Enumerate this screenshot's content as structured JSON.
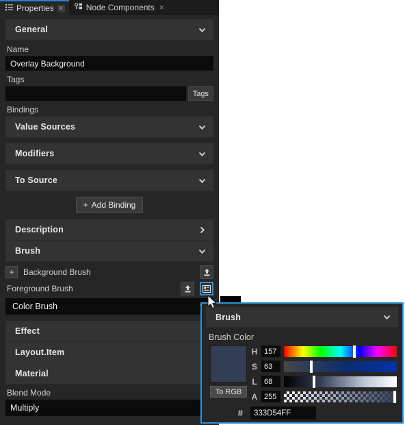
{
  "tabs": [
    {
      "label": "Properties",
      "icon": "list-icon",
      "close": "✕",
      "active": true
    },
    {
      "label": "Node Components",
      "icon": "node-icon",
      "close": "✕",
      "active": false
    }
  ],
  "accent": "#2f8fd8",
  "general": {
    "title": "General",
    "name_label": "Name",
    "name_value": "Overlay Background",
    "tags_label": "Tags",
    "tags_value": "",
    "tags_button": "Tags",
    "bindings_label": "Bindings",
    "binding_sections": [
      {
        "title": "Value Sources",
        "state": "expanded"
      },
      {
        "title": "Modifiers",
        "state": "expanded"
      },
      {
        "title": "To Source",
        "state": "expanded"
      }
    ],
    "add_binding": "Add Binding",
    "add_binding_plus": "+"
  },
  "sections": [
    {
      "title": "Description",
      "state": "collapsed"
    },
    {
      "title": "Brush",
      "state": "expanded"
    }
  ],
  "brush": {
    "background_brush_label": "Background Brush",
    "background_add": "+",
    "foreground_brush_label": "Foreground Brush",
    "combo_value": "Color Brush"
  },
  "lower_sections": [
    {
      "title": "Effect",
      "state": "collapsed"
    },
    {
      "title": "Layout.Item",
      "state": "collapsed"
    },
    {
      "title": "Material",
      "state": "collapsed"
    }
  ],
  "material": {
    "blend_mode_label": "Blend Mode",
    "blend_mode_value": "Multiply"
  },
  "popup": {
    "title": "Brush",
    "brush_color_label": "Brush Color",
    "to_rgb_button": "To RGB",
    "swatch_color": "#333d54",
    "channels": [
      {
        "name": "H",
        "value": "157",
        "thumb_pct": 62.5
      },
      {
        "name": "S",
        "value": "63",
        "thumb_pct": 24.0
      },
      {
        "name": "L",
        "value": "68",
        "thumb_pct": 26.5
      },
      {
        "name": "A",
        "value": "255",
        "thumb_pct": 98.0
      }
    ],
    "hex_label": "#",
    "hex_value": "333D54FF"
  }
}
